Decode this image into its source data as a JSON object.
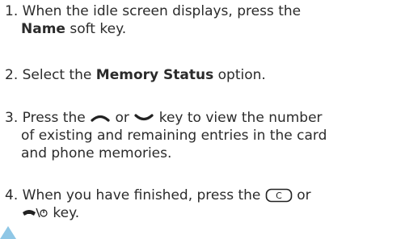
{
  "steps": [
    {
      "number": "1.",
      "text_a": "When the idle screen displays, press the",
      "bold": "Name",
      "text_b": "soft key."
    },
    {
      "number": "2.",
      "text_a": "Select the",
      "bold": "Memory Status",
      "text_b": "option."
    },
    {
      "number": "3.",
      "text_a": "Press the",
      "or": "or",
      "text_b": "key to view the number",
      "line2": "of existing and remaining entries in the card",
      "line3": "and phone memories."
    },
    {
      "number": "4.",
      "text_a": "When you have finished, press the",
      "or": "or",
      "text_b": "key."
    }
  ],
  "icons": {
    "up_key": "up-navigation-key-icon",
    "down_key": "down-navigation-key-icon",
    "clear_key": "c-clear-key-icon",
    "end_key": "end-power-key-icon",
    "c_key_label": "C"
  },
  "colors": {
    "text": "#2b2b2b",
    "marker": "#8fc7e6"
  }
}
